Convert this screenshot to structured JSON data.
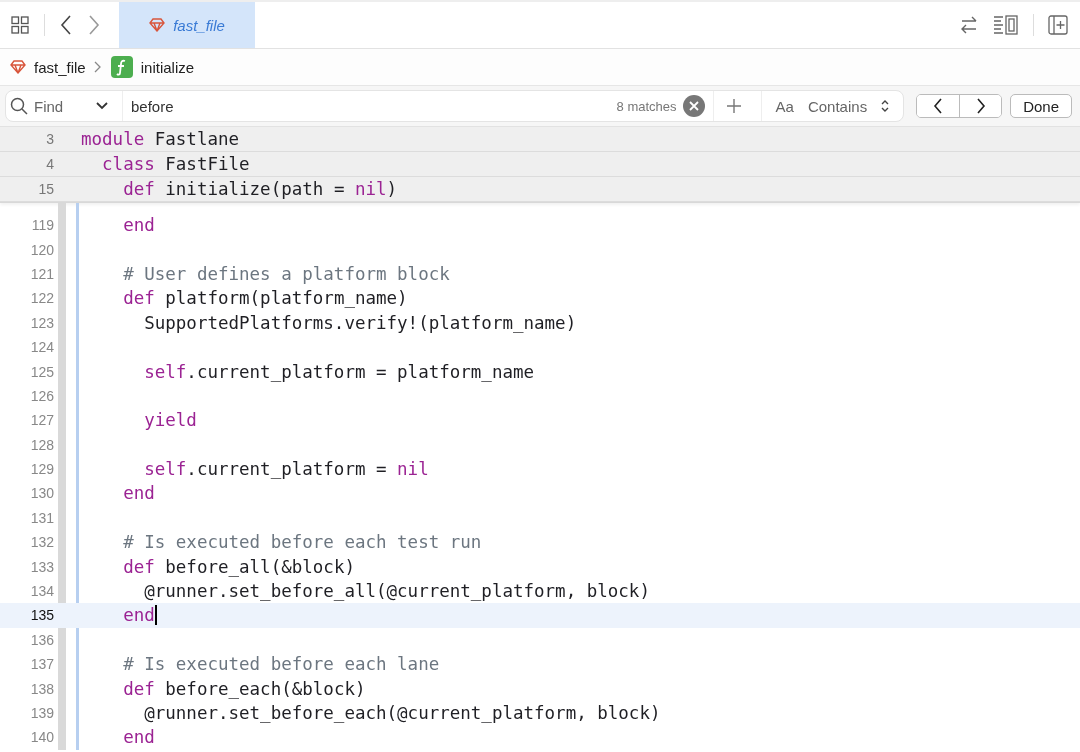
{
  "tab": {
    "label": "fast_file",
    "selected": true
  },
  "breadcrumb": [
    {
      "label": "fast_file",
      "kind": "file"
    },
    {
      "label": "initialize",
      "kind": "function"
    }
  ],
  "find": {
    "mode": "Find",
    "value": "before",
    "matches": "8 matches",
    "case_toggle": "Aa",
    "match_type": "Contains",
    "done": "Done"
  },
  "sticky_lines": [
    {
      "number": "3",
      "tokens": [
        {
          "kind": "keyword",
          "text": "module"
        },
        {
          "kind": "plain",
          "text": " Fastlane"
        }
      ]
    },
    {
      "number": "4",
      "tokens": [
        {
          "kind": "keyword",
          "text": "  class"
        },
        {
          "kind": "plain",
          "text": " FastFile"
        }
      ]
    },
    {
      "number": "15",
      "tokens": [
        {
          "kind": "keyword",
          "text": "    def"
        },
        {
          "kind": "plain",
          "text": " initialize(path = "
        },
        {
          "kind": "keyword",
          "text": "nil"
        },
        {
          "kind": "plain",
          "text": ")"
        }
      ]
    }
  ],
  "lines": [
    {
      "number": "119",
      "current": false,
      "tokens": [
        {
          "kind": "keyword",
          "text": "    end"
        }
      ]
    },
    {
      "number": "120",
      "current": false
    },
    {
      "number": "121",
      "current": false,
      "tokens": [
        {
          "kind": "comment",
          "text": "    # User defines a platform block"
        }
      ]
    },
    {
      "number": "122",
      "current": false,
      "tokens": [
        {
          "kind": "keyword",
          "text": "    def"
        },
        {
          "kind": "plain",
          "text": " platform(platform_name)"
        }
      ]
    },
    {
      "number": "123",
      "current": false,
      "tokens": [
        {
          "kind": "plain",
          "text": "      SupportedPlatforms.verify!(platform_name)"
        }
      ]
    },
    {
      "number": "124",
      "current": false
    },
    {
      "number": "125",
      "current": false,
      "tokens": [
        {
          "kind": "keyword",
          "text": "      self"
        },
        {
          "kind": "plain",
          "text": ".current_platform = platform_name"
        }
      ]
    },
    {
      "number": "126",
      "current": false
    },
    {
      "number": "127",
      "current": false,
      "tokens": [
        {
          "kind": "keyword",
          "text": "      yield"
        }
      ]
    },
    {
      "number": "128",
      "current": false
    },
    {
      "number": "129",
      "current": false,
      "tokens": [
        {
          "kind": "keyword",
          "text": "      self"
        },
        {
          "kind": "plain",
          "text": ".current_platform = "
        },
        {
          "kind": "keyword",
          "text": "nil"
        }
      ]
    },
    {
      "number": "130",
      "current": false,
      "tokens": [
        {
          "kind": "keyword",
          "text": "    end"
        }
      ]
    },
    {
      "number": "131",
      "current": false
    },
    {
      "number": "132",
      "current": false,
      "tokens": [
        {
          "kind": "comment",
          "text": "    # Is executed before each test run"
        }
      ]
    },
    {
      "number": "133",
      "current": false,
      "tokens": [
        {
          "kind": "keyword",
          "text": "    def"
        },
        {
          "kind": "plain",
          "text": " before_all(&block)"
        }
      ]
    },
    {
      "number": "134",
      "current": false,
      "tokens": [
        {
          "kind": "plain",
          "text": "      @runner.set_before_all(@current_platform, block)"
        }
      ]
    },
    {
      "number": "135",
      "current": true,
      "tokens": [
        {
          "kind": "keyword",
          "text": "    end"
        }
      ]
    },
    {
      "number": "136",
      "current": false
    },
    {
      "number": "137",
      "current": false,
      "tokens": [
        {
          "kind": "comment",
          "text": "    # Is executed before each lane"
        }
      ]
    },
    {
      "number": "138",
      "current": false,
      "tokens": [
        {
          "kind": "keyword",
          "text": "    def"
        },
        {
          "kind": "plain",
          "text": " before_each(&block)"
        }
      ]
    },
    {
      "number": "139",
      "current": false,
      "tokens": [
        {
          "kind": "plain",
          "text": "      @runner.set_before_each(@current_platform, block)"
        }
      ]
    },
    {
      "number": "140",
      "current": false,
      "tokens": [
        {
          "kind": "keyword",
          "text": "    end"
        }
      ]
    }
  ]
}
